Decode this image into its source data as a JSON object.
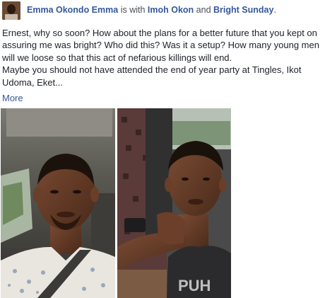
{
  "post": {
    "author": "Emma Okondo Emma",
    "with_text": "is with",
    "tag_1": "Imoh Okon",
    "and_text": "and",
    "tag_2": "Bright Sunday",
    "period": ".",
    "paragraph_1": "Ernest, why so soon? How about the plans for a better future that you kept on assuring me was bright? Who did this? Was it a setup? How many young men will we loose so that this act of nefarious killings will end.",
    "paragraph_2": "Maybe you should not have attended the end of year party at Tingles, Ikot Udoma, Eket...",
    "more_label": "More"
  },
  "colors": {
    "link": "#365899",
    "text": "#1d2129",
    "meta_text": "#4b4f56"
  },
  "icons": {
    "avatar": "profile-photo",
    "photo_1": "selfie-in-car-white-shirt",
    "photo_2": "selfie-in-car-black-tank-top"
  }
}
